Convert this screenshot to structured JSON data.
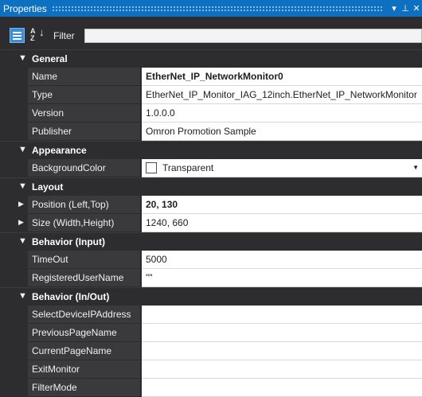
{
  "window": {
    "title": "Properties",
    "pin_icon": "pin-icon",
    "close_icon": "close-icon",
    "menu_icon": "dropdown-icon"
  },
  "toolbar": {
    "categorized_icon": "categorized-view-icon",
    "sort_icon": "sort-alphabetical-icon",
    "filter_label": "Filter",
    "filter_value": ""
  },
  "grid": {
    "categories": {
      "general": "General",
      "appearance": "Appearance",
      "layout": "Layout",
      "behavior_input": "Behavior (Input)",
      "behavior_inout": "Behavior (In/Out)"
    },
    "properties": {
      "name": {
        "label": "Name",
        "value": "EtherNet_IP_NetworkMonitor0"
      },
      "type": {
        "label": "Type",
        "value": "EtherNet_IP_Monitor_IAG_12inch.EtherNet_IP_NetworkMonitor"
      },
      "version": {
        "label": "Version",
        "value": "1.0.0.0"
      },
      "publisher": {
        "label": "Publisher",
        "value": "Omron Promotion Sample"
      },
      "background_color": {
        "label": "BackgroundColor",
        "value": "Transparent"
      },
      "position": {
        "label": "Position (Left,Top)",
        "value": "20, 130"
      },
      "size": {
        "label": "Size (Width,Height)",
        "value": "1240, 660"
      },
      "timeout": {
        "label": "TimeOut",
        "value": "5000"
      },
      "registered_user": {
        "label": "RegisteredUserName",
        "value": "\"\""
      },
      "select_device_ip": {
        "label": "SelectDeviceIPAddress",
        "value": ""
      },
      "previous_page": {
        "label": "PreviousPageName",
        "value": ""
      },
      "current_page": {
        "label": "CurrentPageName",
        "value": ""
      },
      "exit_monitor": {
        "label": "ExitMonitor",
        "value": ""
      },
      "filter_mode": {
        "label": "FilterMode",
        "value": ""
      }
    }
  }
}
